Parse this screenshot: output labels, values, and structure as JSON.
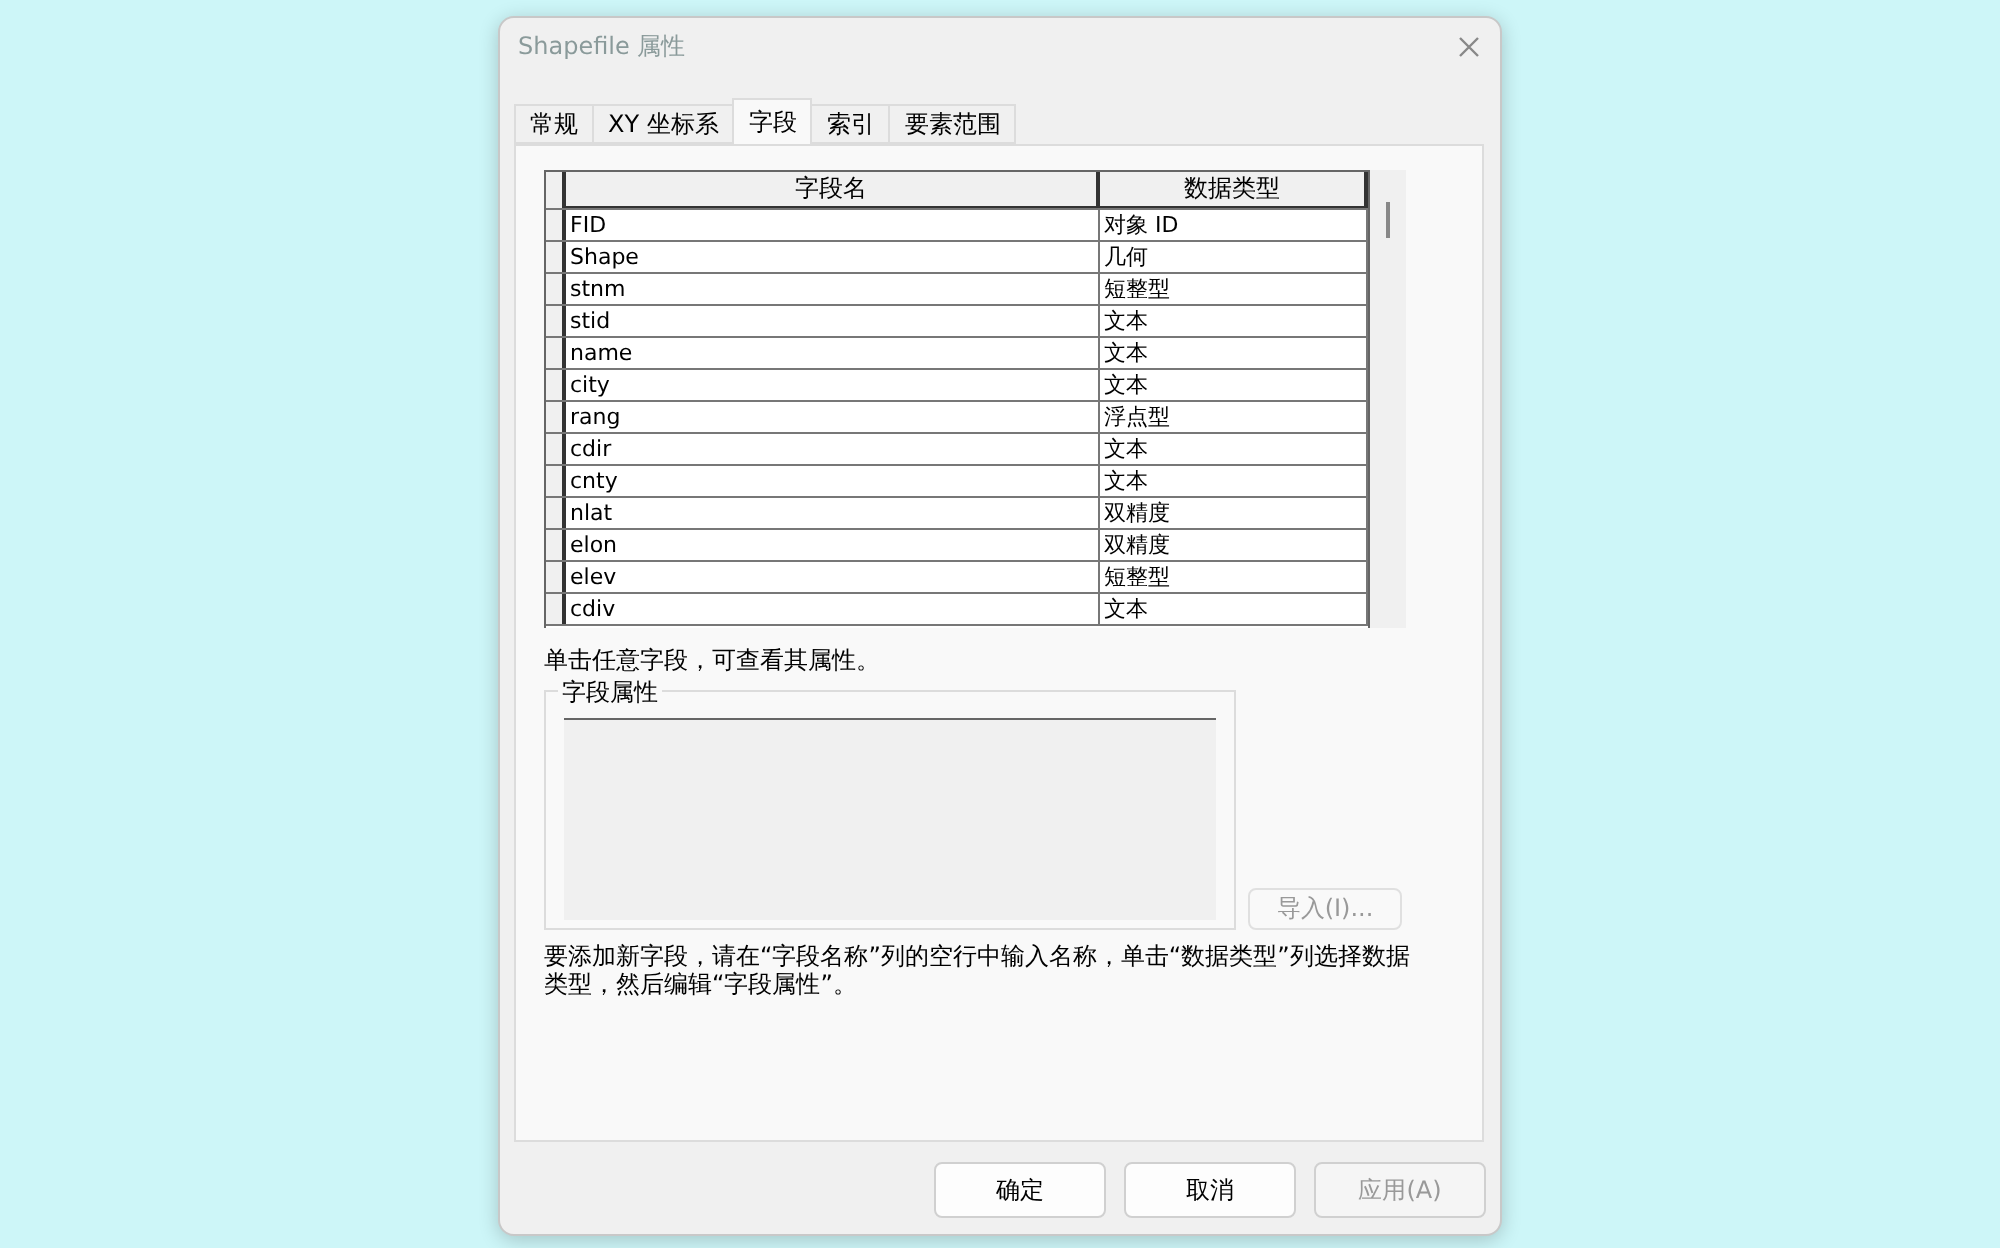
{
  "window": {
    "title": "Shapefile 属性"
  },
  "tabs": [
    {
      "label": "常规",
      "selected": false
    },
    {
      "label": "XY 坐标系",
      "selected": false
    },
    {
      "label": "字段",
      "selected": true
    },
    {
      "label": "索引",
      "selected": false
    },
    {
      "label": "要素范围",
      "selected": false
    }
  ],
  "table": {
    "columns": [
      "字段名",
      "数据类型"
    ],
    "rows": [
      [
        "FID",
        "对象 ID"
      ],
      [
        "Shape",
        "几何"
      ],
      [
        "stnm",
        "短整型"
      ],
      [
        "stid",
        "文本"
      ],
      [
        "name",
        "文本"
      ],
      [
        "city",
        "文本"
      ],
      [
        "rang",
        "浮点型"
      ],
      [
        "cdir",
        "文本"
      ],
      [
        "cnty",
        "文本"
      ],
      [
        "nlat",
        "双精度"
      ],
      [
        "elon",
        "双精度"
      ],
      [
        "elev",
        "短整型"
      ],
      [
        "cdiv",
        "文本"
      ]
    ]
  },
  "hint": "单击任意字段，可查看其属性。",
  "field_properties": {
    "title": "字段属性"
  },
  "import_button": {
    "label": "导入(I)...",
    "disabled": true
  },
  "instructions": "要添加新字段，请在“字段名称”列的空行中输入名称，单击“数据类型”列选择数据类型，然后编辑“字段属性”。",
  "buttons": [
    {
      "label": "确定",
      "disabled": false
    },
    {
      "label": "取消",
      "disabled": false
    },
    {
      "label": "应用(A)",
      "disabled": true
    }
  ]
}
